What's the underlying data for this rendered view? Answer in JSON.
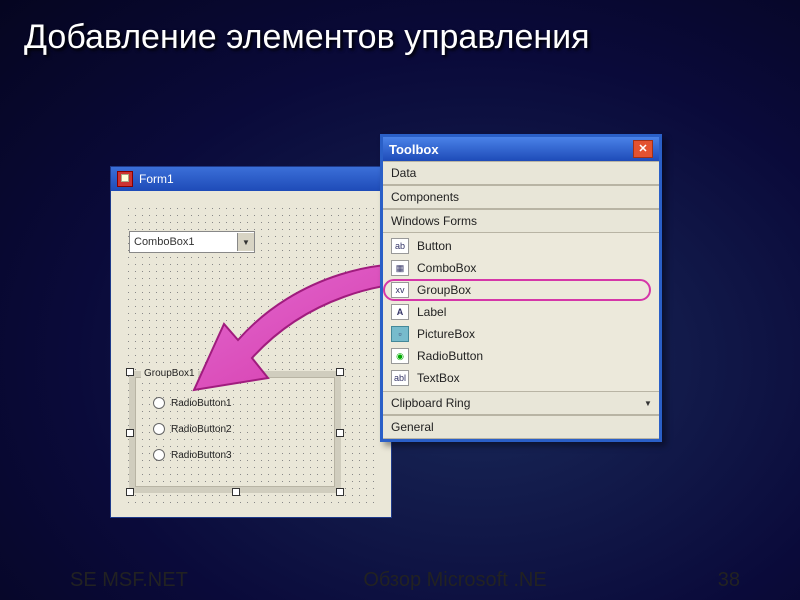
{
  "slide": {
    "title": "Добавление элементов управления",
    "footer_left": "SE MSF.NET",
    "footer_center": "Обзор Microsoft .NE",
    "footer_page": "38"
  },
  "form1": {
    "title": "Form1",
    "combobox_value": "ComboBox1",
    "groupbox_label": "GroupBox1",
    "radios": [
      "RadioButton1",
      "RadioButton2",
      "RadioButton3"
    ]
  },
  "toolbox": {
    "title": "Toolbox",
    "sections_top": [
      "Data",
      "Components",
      "Windows Forms"
    ],
    "items": [
      {
        "icon": "ab",
        "label": "Button"
      },
      {
        "icon": "▦",
        "label": "ComboBox"
      },
      {
        "icon": "xv",
        "label": "GroupBox",
        "selected": true
      },
      {
        "icon": "A",
        "label": "Label"
      },
      {
        "icon": "▫",
        "label": "PictureBox"
      },
      {
        "icon": "◉",
        "label": "RadioButton"
      },
      {
        "icon": "abl",
        "label": "TextBox"
      }
    ],
    "sections_bottom": [
      "Clipboard Ring",
      "General"
    ]
  }
}
